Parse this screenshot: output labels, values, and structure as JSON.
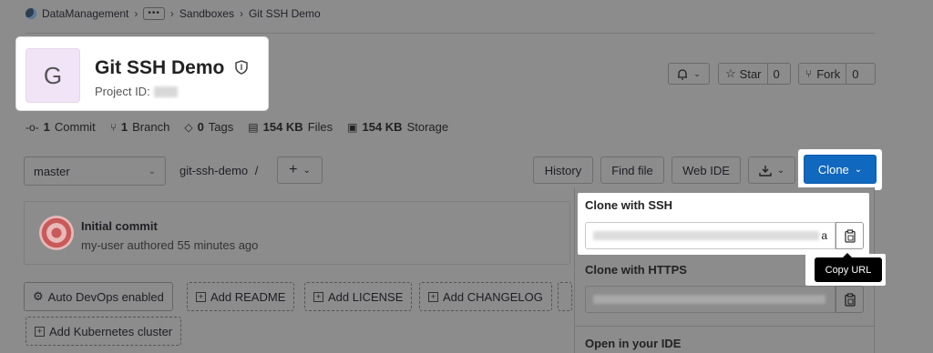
{
  "breadcrumb": {
    "org": "DataManagement",
    "more": "•••",
    "group": "Sandboxes",
    "project": "Git SSH Demo",
    "sep": "›"
  },
  "project": {
    "avatar_letter": "G",
    "title": "Git SSH Demo",
    "id_label": "Project ID:"
  },
  "actions": {
    "star_label": "Star",
    "star_count": "0",
    "fork_label": "Fork",
    "fork_count": "0"
  },
  "stats": {
    "commits_count": "1",
    "commits_label": "Commit",
    "branches_count": "1",
    "branches_label": "Branch",
    "tags_count": "0",
    "tags_label": "Tags",
    "files_size": "154 KB",
    "files_label": "Files",
    "storage_size": "154 KB",
    "storage_label": "Storage"
  },
  "repo": {
    "branch": "master",
    "path": "git-ssh-demo",
    "path_sep": "/",
    "history": "History",
    "find_file": "Find file",
    "web_ide": "Web IDE",
    "clone": "Clone"
  },
  "commit": {
    "title": "Initial commit",
    "meta": "my-user authored 55 minutes ago"
  },
  "quick_actions": [
    {
      "label": "Auto DevOps enabled"
    },
    {
      "label": "Add README"
    },
    {
      "label": "Add LICENSE"
    },
    {
      "label": "Add CHANGELOG"
    },
    {
      "label": "Add Kubernetes cluster"
    }
  ],
  "clone_panel": {
    "ssh_label": "Clone with SSH",
    "ssh_value_tail": "a",
    "copy_tooltip": "Copy URL",
    "https_label": "Clone with HTTPS",
    "ide_label": "Open in your IDE"
  },
  "colors": {
    "overlay": "#8c8c8c",
    "clone_button": "#1068bf",
    "avatar_bg": "#f1e4f7"
  }
}
